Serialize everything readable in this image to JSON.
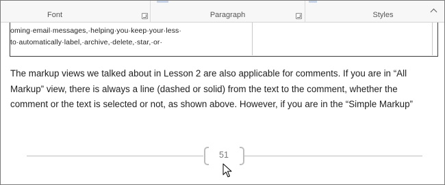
{
  "ribbon": {
    "groups": [
      {
        "label": "Font"
      },
      {
        "label": "Paragraph"
      },
      {
        "label": "Styles"
      }
    ],
    "icons": [
      "dialog-launcher-icon",
      "collapse-ribbon-icon"
    ]
  },
  "embedded_image": {
    "line1": "oming·email·messages,·helping·you·keep·your·less·",
    "line2": "to·automatically·label,·archive,·delete,·star,·or·"
  },
  "body": {
    "lines": [
      "The markup views we talked about in Lesson 2 are also applicable for comments. If you are in “All",
      "Markup” view, there is always a line (dashed or solid) from the text to the comment, whether the",
      "comment or the text is selected or not, as shown above. However, if you are in the “Simple Markup”"
    ]
  },
  "footer": {
    "page_number": "51"
  },
  "cursor": {
    "icon": "mouse-pointer-icon"
  }
}
